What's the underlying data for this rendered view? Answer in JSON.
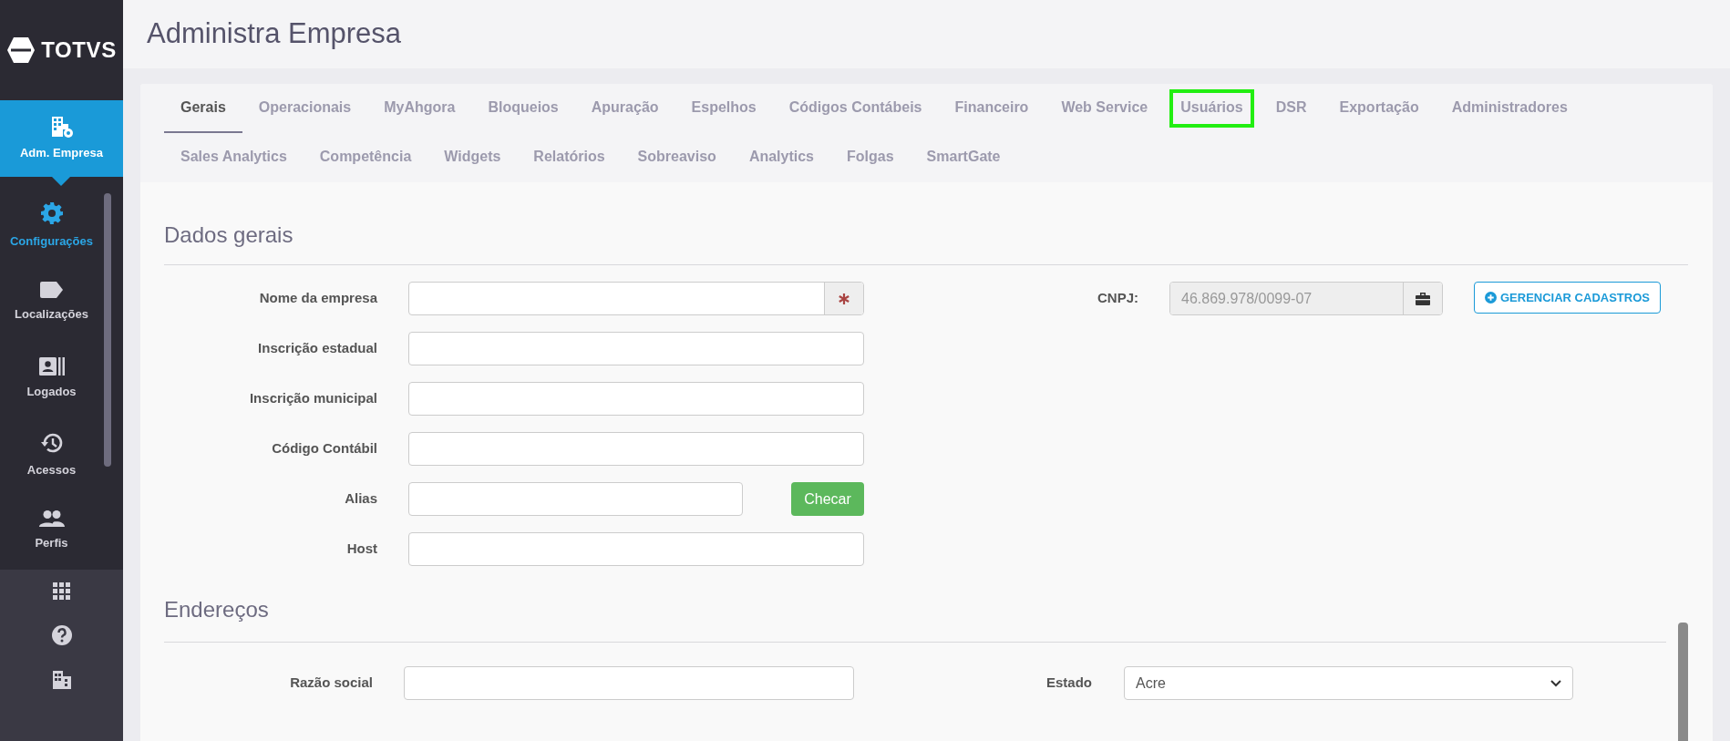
{
  "sidebar": {
    "logo": "TOTVS",
    "module": {
      "label": "Adm. Empresa"
    },
    "items": [
      {
        "label": "Configurações",
        "selected": true
      },
      {
        "label": "Localizações",
        "selected": false
      },
      {
        "label": "Logados",
        "selected": false
      },
      {
        "label": "Acessos",
        "selected": false
      },
      {
        "label": "Perfis",
        "selected": false
      }
    ]
  },
  "page_title": "Administra Empresa",
  "tabs": [
    [
      {
        "label": "Gerais",
        "selected": true,
        "highlighted": false
      },
      {
        "label": "Operacionais",
        "selected": false,
        "highlighted": false
      },
      {
        "label": "MyAhgora",
        "selected": false,
        "highlighted": false
      },
      {
        "label": "Bloqueios",
        "selected": false,
        "highlighted": false
      },
      {
        "label": "Apuração",
        "selected": false,
        "highlighted": false
      },
      {
        "label": "Espelhos",
        "selected": false,
        "highlighted": false
      },
      {
        "label": "Códigos Contábeis",
        "selected": false,
        "highlighted": false
      },
      {
        "label": "Financeiro",
        "selected": false,
        "highlighted": false
      },
      {
        "label": "Web Service",
        "selected": false,
        "highlighted": false
      },
      {
        "label": "Usuários",
        "selected": false,
        "highlighted": true
      },
      {
        "label": "DSR",
        "selected": false,
        "highlighted": false
      },
      {
        "label": "Exportação",
        "selected": false,
        "highlighted": false
      },
      {
        "label": "Administradores",
        "selected": false,
        "highlighted": false
      }
    ],
    [
      {
        "label": "Sales Analytics",
        "selected": false,
        "highlighted": false
      },
      {
        "label": "Competência",
        "selected": false,
        "highlighted": false
      },
      {
        "label": "Widgets",
        "selected": false,
        "highlighted": false
      },
      {
        "label": "Relatórios",
        "selected": false,
        "highlighted": false
      },
      {
        "label": "Sobreaviso",
        "selected": false,
        "highlighted": false
      },
      {
        "label": "Analytics",
        "selected": false,
        "highlighted": false
      },
      {
        "label": "Folgas",
        "selected": false,
        "highlighted": false
      },
      {
        "label": "SmartGate",
        "selected": false,
        "highlighted": false
      }
    ]
  ],
  "dados_gerais": {
    "title": "Dados gerais",
    "fields": [
      {
        "label": "Nome da empresa",
        "kind": "required"
      },
      {
        "label": "Inscrição estadual",
        "kind": "text"
      },
      {
        "label": "Inscrição municipal",
        "kind": "text"
      },
      {
        "label": "Código Contábil",
        "kind": "text"
      },
      {
        "label": "Alias",
        "kind": "check",
        "button": "Checar"
      },
      {
        "label": "Host",
        "kind": "text"
      }
    ],
    "cnpj": {
      "label": "CNPJ:",
      "value": "46.869.978/0099-07",
      "disabled": true
    },
    "manage_button": "GERENCIAR CADASTROS"
  },
  "enderecos": {
    "title": "Endereços",
    "razao_social": {
      "label": "Razão social"
    },
    "estado": {
      "label": "Estado",
      "value": "Acre"
    }
  }
}
